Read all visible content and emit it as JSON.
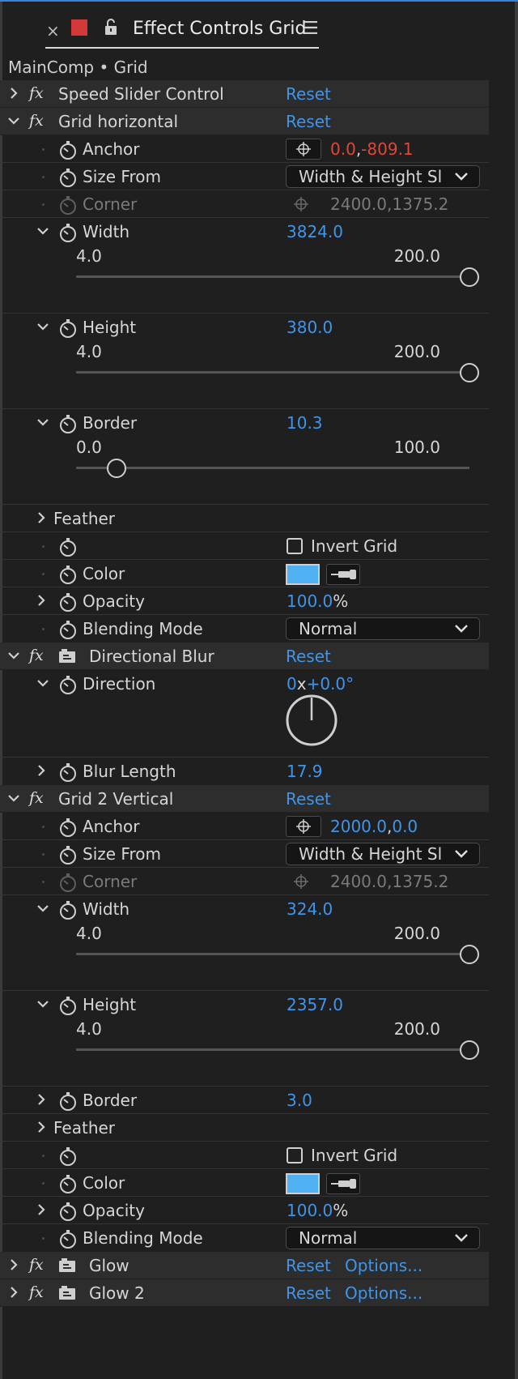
{
  "tab": {
    "close": "×",
    "title": "Effect Controls Grid",
    "menu": "☰",
    "swatch_color": "#d23939"
  },
  "comp_name": "MainComp • Grid",
  "colors": {
    "accent": "#3f95ea",
    "highlight": "#e2453a",
    "swatch": "#4fb0f2"
  },
  "effects": {
    "speed": {
      "name": "Speed Slider Control",
      "reset": "Reset"
    },
    "gridh": {
      "name": "Grid horizontal",
      "reset": "Reset",
      "anchor": {
        "label": "Anchor",
        "x": "0.0",
        "y": "-809.1"
      },
      "size_from": {
        "label": "Size From",
        "value": "Width & Height Sl"
      },
      "corner": {
        "label": "Corner",
        "value": "2400.0,1375.2"
      },
      "width": {
        "label": "Width",
        "value": "3824.0",
        "min": "4.0",
        "max": "200.0",
        "level": 1.0
      },
      "height": {
        "label": "Height",
        "value": "380.0",
        "min": "4.0",
        "max": "200.0",
        "level": 1.0
      },
      "border": {
        "label": "Border",
        "value": "10.3",
        "min": "0.0",
        "max": "100.0",
        "level": 0.103
      },
      "feather": {
        "label": "Feather"
      },
      "invert": {
        "label": "Invert Grid",
        "checked": false
      },
      "color": {
        "label": "Color",
        "value": "#4fb0f2"
      },
      "opacity": {
        "label": "Opacity",
        "value": "100.0",
        "unit": "%"
      },
      "blend": {
        "label": "Blending Mode",
        "value": "Normal"
      }
    },
    "dblur": {
      "name": "Directional Blur",
      "reset": "Reset",
      "direction": {
        "label": "Direction",
        "revs": "0",
        "x": "x",
        "deg": "+0.0°"
      },
      "blur_length": {
        "label": "Blur Length",
        "value": "17.9"
      }
    },
    "gridv": {
      "name": "Grid 2 Vertical",
      "reset": "Reset",
      "anchor": {
        "label": "Anchor",
        "x": "2000.0",
        "y": "0.0"
      },
      "size_from": {
        "label": "Size From",
        "value": "Width & Height Sl"
      },
      "corner": {
        "label": "Corner",
        "value": "2400.0,1375.2"
      },
      "width": {
        "label": "Width",
        "value": "324.0",
        "min": "4.0",
        "max": "200.0",
        "level": 1.0
      },
      "height": {
        "label": "Height",
        "value": "2357.0",
        "min": "4.0",
        "max": "200.0",
        "level": 1.0
      },
      "border": {
        "label": "Border",
        "value": "3.0"
      },
      "feather": {
        "label": "Feather"
      },
      "invert": {
        "label": "Invert Grid",
        "checked": false
      },
      "color": {
        "label": "Color",
        "value": "#4fb0f2"
      },
      "opacity": {
        "label": "Opacity",
        "value": "100.0",
        "unit": "%"
      },
      "blend": {
        "label": "Blending Mode",
        "value": "Normal"
      }
    },
    "glow": {
      "name": "Glow",
      "reset": "Reset",
      "options": "Options..."
    },
    "glow2": {
      "name": "Glow 2",
      "reset": "Reset",
      "options": "Options..."
    }
  },
  "icons": {
    "fx": "fx",
    "twirl_open": "chevron-down-icon",
    "twirl_closed": "chevron-right-icon",
    "stopwatch": "stopwatch-icon",
    "anchor": "crosshair-icon",
    "eyedropper": "eyedropper-icon",
    "preset": "preset-icon",
    "lock": "lock-icon"
  }
}
